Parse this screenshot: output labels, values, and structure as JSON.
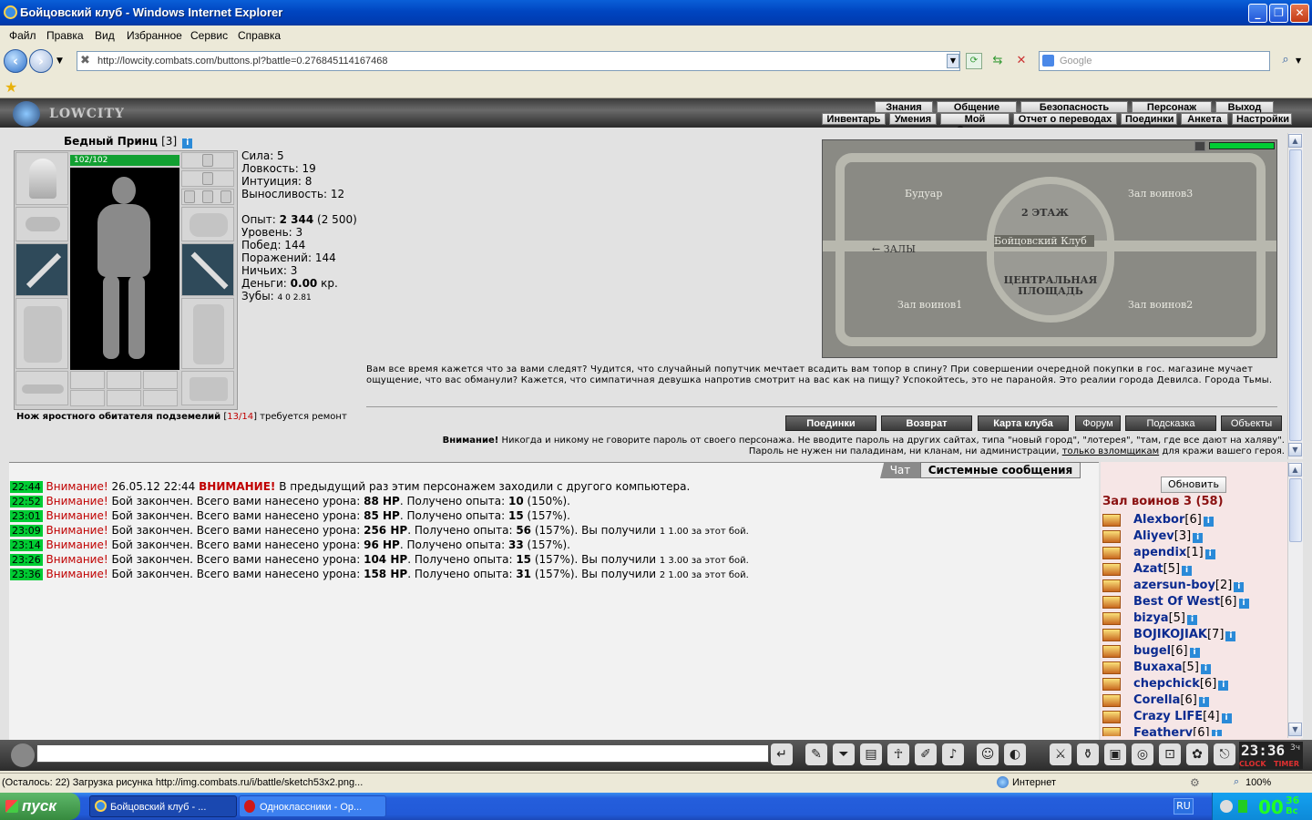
{
  "window": {
    "title": "Бойцовский клуб - Windows Internet Explorer"
  },
  "menu": [
    "Файл",
    "Правка",
    "Вид",
    "Избранное",
    "Сервис",
    "Справка"
  ],
  "address": {
    "url": "http://lowcity.combats.com/buttons.pl?battle=0.276845114167468",
    "search_placeholder": "Google"
  },
  "game": {
    "logo": "LOWCITY",
    "nav_top": [
      "Знания",
      "Общение",
      "Безопасность",
      "Персонаж",
      "Выход"
    ],
    "nav_bottom": [
      "Инвентарь",
      "Умения",
      "Мой Скролл",
      "Отчет о переводах",
      "Поединки",
      "Анкета",
      "Настройки"
    ],
    "character": {
      "name": "Бедный Принц",
      "level": "[3]",
      "hp": "102/102"
    },
    "stats": {
      "strength": "Сила: 5",
      "agility": "Ловкость: 19",
      "intuition": "Интуиция: 8",
      "endurance": "Выносливость: 12",
      "exp_label": "Опыт:",
      "exp_value": "2 344",
      "exp_next": "(2 500)",
      "level": "Уровень: 3",
      "wins": "Побед: 144",
      "losses": "Поражений: 144",
      "draws": "Ничьих: 3",
      "money_label": "Деньги:",
      "money_value": "0.00",
      "money_unit": "кр.",
      "teeth_label": "Зубы:",
      "teeth_values": "4  0  2.81"
    },
    "item_notice": {
      "name": "Нож яростного обитателя подземелий",
      "durability": "13/14",
      "suffix": "требуется ремонт"
    },
    "map": {
      "labels": [
        "Будуар",
        "Зал воинов3",
        "2 ЭТАЖ",
        "Бойцовский Клуб",
        "← ЗАЛЫ",
        "ЦЕНТРАЛЬНАЯ ПЛОЩАДЬ",
        "Зал воинов1",
        "Зал воинов2"
      ]
    },
    "description": "Вам все время кажется что за вами следят? Чудится, что случайный попутчик мечтает всадить вам топор в спину? При совершении очередной покупки в гос. магазине мучает ощущение, что вас обманули? Кажется, что симпатичная девушка напротив смотрит на вас как на пищу? Успокойтесь, это не паранойя. Это реалии города Девилса. Города Тьмы.",
    "actions": [
      "Поединки",
      "Возврат",
      "Карта клуба",
      "Форум",
      "Подсказка",
      "Объекты"
    ],
    "warning": {
      "title": "Внимание!",
      "text1": "Никогда и никому не говорите пароль от своего персонажа. Не вводите пароль на других сайтах, типа \"новый город\", \"лотерея\", \"там, где все дают на халяву\".",
      "text2": "Пароль не нужен ни паладинам, ни кланам, ни администрации,",
      "link": "только взломщикам",
      "text3": "для кражи вашего героя."
    },
    "chat_tabs": [
      "Чат",
      "Системные сообщения"
    ],
    "chat": [
      {
        "time": "22:44",
        "label": "Внимание!",
        "text": "26.05.12 22:44",
        "bold": "ВНИМАНИЕ!",
        "rest": "В предыдущий раз этим персонажем заходили с другого компьютера."
      },
      {
        "time": "22:52",
        "label": "Внимание!",
        "text": "Бой закончен. Всего вами нанесено урона:",
        "dmg": "88 HP",
        "exp": "10",
        "pct": "(150%).",
        "reward": ""
      },
      {
        "time": "23:01",
        "label": "Внимание!",
        "text": "Бой закончен. Всего вами нанесено урона:",
        "dmg": "85 HP",
        "exp": "15",
        "pct": "(157%).",
        "reward": ""
      },
      {
        "time": "23:09",
        "label": "Внимание!",
        "text": "Бой закончен. Всего вами нанесено урона:",
        "dmg": "256 HP",
        "exp": "56",
        "pct": "(157%). Вы получили",
        "reward": "1  1.00 за этот бой."
      },
      {
        "time": "23:14",
        "label": "Внимание!",
        "text": "Бой закончен. Всего вами нанесено урона:",
        "dmg": "96 HP",
        "exp": "33",
        "pct": "(157%).",
        "reward": ""
      },
      {
        "time": "23:26",
        "label": "Внимание!",
        "text": "Бой закончен. Всего вами нанесено урона:",
        "dmg": "104 HP",
        "exp": "15",
        "pct": "(157%). Вы получили",
        "reward": "1  3.00 за этот бой."
      },
      {
        "time": "23:36",
        "label": "Внимание!",
        "text": "Бой закончен. Всего вами нанесено урона:",
        "dmg": "158 HP",
        "exp": "31",
        "pct": "(157%). Вы получили",
        "reward": "2  1.00 за этот бой."
      }
    ],
    "exp_label": "Получено опыта:",
    "users": {
      "refresh": "Обновить",
      "room": "Зал воинов 3 (58)",
      "list": [
        {
          "name": "Alexbor",
          "lvl": "[6]"
        },
        {
          "name": "Aliyev",
          "lvl": "[3]"
        },
        {
          "name": "apendix",
          "lvl": "[1]"
        },
        {
          "name": "Azat",
          "lvl": "[5]"
        },
        {
          "name": "azersun-boy",
          "lvl": "[2]"
        },
        {
          "name": "Best Of West",
          "lvl": "[6]"
        },
        {
          "name": "bizya",
          "lvl": "[5]"
        },
        {
          "name": "BOJIKOJIAK",
          "lvl": "[7]"
        },
        {
          "name": "bugel",
          "lvl": "[6]"
        },
        {
          "name": "Buxaxa",
          "lvl": "[5]"
        },
        {
          "name": "chepchick",
          "lvl": "[6]"
        },
        {
          "name": "Corella",
          "lvl": "[6]"
        },
        {
          "name": "Crazy LIFE",
          "lvl": "[4]"
        },
        {
          "name": "Feathery",
          "lvl": "[6]"
        }
      ]
    },
    "clock": {
      "time": "23:36",
      "suffix": "3ч",
      "label1": "CLOCK",
      "label2": "TIMER"
    }
  },
  "statusbar": {
    "text": "(Осталось: 22) Загрузка рисунка http://img.combats.ru/i/battle/sketch53x2.png...",
    "zone": "Интернет",
    "zoom": "100%"
  },
  "taskbar": {
    "start": "пуск",
    "tasks": [
      "Бойцовский клуб - ...",
      "Одноклассники - Ор..."
    ],
    "lang": "RU",
    "time": "00",
    "time_sup": "36",
    "time_sub": "Вс"
  },
  "colors": {
    "accent_green": "#00cc33",
    "warning_red": "#c00000",
    "user_blue": "#0b2b90"
  }
}
